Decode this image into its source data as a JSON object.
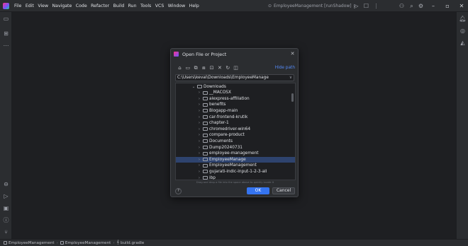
{
  "titlebar": {
    "menu": [
      "File",
      "Edit",
      "View",
      "Navigate",
      "Code",
      "Refactor",
      "Build",
      "Run",
      "Tools",
      "VCS",
      "Window",
      "Help"
    ],
    "run_config": "EmployeeManagement [runShadow]",
    "run_config_chevron": "∨"
  },
  "dialog": {
    "title": "Open File or Project",
    "hide_path_label": "Hide path",
    "path_value": "C:\\Users\\keval\\Downloads\\EmployeeManage",
    "tree": [
      {
        "label": "Downloads",
        "depth": 0,
        "expanded": true,
        "selected": false
      },
      {
        "label": "__MACOSX",
        "depth": 1,
        "expanded": false,
        "selected": false
      },
      {
        "label": "alexpress-affiliation",
        "depth": 1,
        "expanded": false,
        "selected": false
      },
      {
        "label": "benefits",
        "depth": 1,
        "expanded": false,
        "selected": false
      },
      {
        "label": "Blogapp-main",
        "depth": 1,
        "expanded": false,
        "selected": false
      },
      {
        "label": "car-frontend-krutik",
        "depth": 1,
        "expanded": false,
        "selected": false
      },
      {
        "label": "chapter-1",
        "depth": 1,
        "expanded": false,
        "selected": false
      },
      {
        "label": "chromedriver-win64",
        "depth": 1,
        "expanded": false,
        "selected": false
      },
      {
        "label": "compare-product",
        "depth": 1,
        "expanded": false,
        "selected": false
      },
      {
        "label": "Documents",
        "depth": 1,
        "expanded": false,
        "selected": false
      },
      {
        "label": "Dump20240731",
        "depth": 1,
        "expanded": false,
        "selected": false
      },
      {
        "label": "employee-management",
        "depth": 1,
        "expanded": false,
        "selected": false
      },
      {
        "label": "EmployeeManage",
        "depth": 1,
        "expanded": false,
        "selected": true
      },
      {
        "label": "EmployeeManagement",
        "depth": 1,
        "expanded": false,
        "selected": false
      },
      {
        "label": "gujarati-indic-input-1-2-3-all",
        "depth": 1,
        "expanded": false,
        "selected": false
      },
      {
        "label": "ibp",
        "depth": 1,
        "expanded": false,
        "selected": false
      }
    ],
    "hint": "Drag and drop a file into the space above to quickly locate it",
    "help_label": "?",
    "ok_label": "OK",
    "cancel_label": "Cancel"
  },
  "statusbar": {
    "breadcrumbs": [
      "EmployeeManagement",
      "EmployeeManagement",
      "build.gradle"
    ]
  },
  "colors": {
    "background": "#1e1f22",
    "panel": "#2b2d30",
    "accent": "#3574f0",
    "selection": "#2e436e",
    "link": "#548af7"
  }
}
